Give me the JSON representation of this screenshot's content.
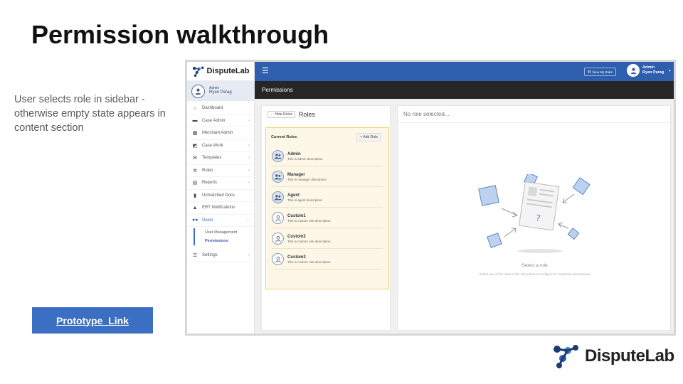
{
  "slide": {
    "title": "Permission walkthrough",
    "description": "User selects role in sidebar - otherwise empty state appears in content section",
    "prototype_link_label": "Prototype_Link",
    "brand_name": "DisputeLab"
  },
  "app": {
    "logo_name": "DisputeLab",
    "sidebar_user": {
      "role": "Admin",
      "name": "Ryan Parag"
    },
    "nav": [
      {
        "label": "Dashboard",
        "icon": "home-icon",
        "chevron": false
      },
      {
        "label": "Case Admin",
        "icon": "briefcase-icon",
        "chevron": true
      },
      {
        "label": "Merchant Admin",
        "icon": "building-icon",
        "chevron": false
      },
      {
        "label": "Case Work",
        "icon": "edit-icon",
        "chevron": true
      },
      {
        "label": "Templates",
        "icon": "envelope-icon",
        "chevron": true
      },
      {
        "label": "Rules",
        "icon": "gear-icon",
        "chevron": true
      },
      {
        "label": "Reports",
        "icon": "document-icon",
        "chevron": true
      },
      {
        "label": "Unmatched Docs",
        "icon": "file-icon",
        "chevron": false
      },
      {
        "label": "ERT Notifications",
        "icon": "warning-icon",
        "chevron": false
      },
      {
        "label": "Users",
        "icon": "users-icon",
        "chevron": true
      }
    ],
    "users_subnav": [
      "User Management",
      "Permissions"
    ],
    "settings_label": "Settings",
    "topbar": {
      "view_stats_label": "View My Stats",
      "user_role": "Admin",
      "user_name": "Ryan Parag"
    },
    "page_title": "Permissions",
    "roles_panel": {
      "hide_label": "Hide Roles",
      "title": "Roles",
      "current_roles_label": "Current Roles",
      "add_role_label": "Add Role",
      "roles": [
        {
          "name": "Admin",
          "description": "This is admin description",
          "icon": "group-icon"
        },
        {
          "name": "Manager",
          "description": "This is manager description",
          "icon": "group-icon"
        },
        {
          "name": "Agent",
          "description": "This is agent description",
          "icon": "group-icon"
        },
        {
          "name": "Custom1",
          "description": "This is custom role description",
          "icon": "user-icon"
        },
        {
          "name": "Custom2",
          "description": "This is custom role description",
          "icon": "user-icon"
        },
        {
          "name": "Custom3",
          "description": "This is custom role description",
          "icon": "user-icon"
        }
      ]
    },
    "detail_panel": {
      "header": "No role selected...",
      "empty_title": "Select a role",
      "empty_subtitle": "Select one of the roles in the side panel to configure its respective permissions"
    }
  },
  "colors": {
    "primary_blue": "#2e5fae",
    "button_blue": "#3b6fc4",
    "roles_highlight": "#fcf7e6",
    "roles_border": "#efd379",
    "page_bar": "#262626"
  }
}
